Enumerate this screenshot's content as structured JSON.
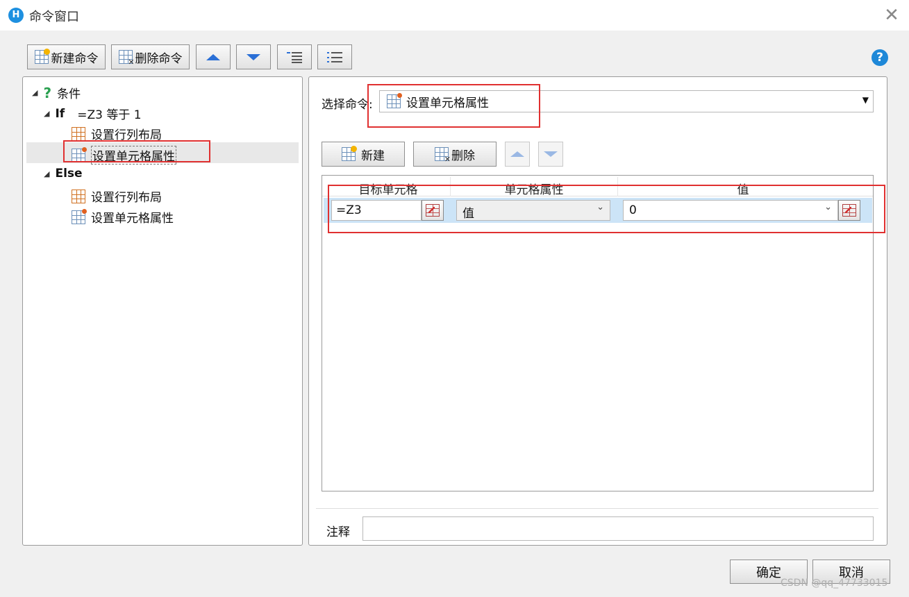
{
  "window": {
    "app_icon_letter": "H",
    "title": "命令窗口",
    "close_glyph": "✕"
  },
  "toolbar": {
    "new_command": "新建命令",
    "delete_command": "删除命令",
    "help": "?"
  },
  "tree": {
    "condition": "条件",
    "if_keyword": "If",
    "if_expr": "=Z3 等于 1",
    "if_children": [
      "设置行列布局",
      "设置单元格属性"
    ],
    "else_keyword": "Else",
    "else_children": [
      "设置行列布局",
      "设置单元格属性"
    ]
  },
  "editor": {
    "select_label": "选择命令:",
    "selected_command": "设置单元格属性",
    "new_label": "新建",
    "delete_label": "删除",
    "columns": [
      "目标单元格",
      "单元格属性",
      "值"
    ],
    "rows": [
      {
        "target": "=Z3",
        "property": "值",
        "value": "0"
      }
    ],
    "note_label": "注释",
    "note_value": ""
  },
  "footer": {
    "ok": "确定",
    "cancel": "取消"
  },
  "watermark": "CSDN @qq_47733015",
  "colors": {
    "highlight_red": "#e03030",
    "row_selected": "#cce4f7",
    "accent_blue": "#2a6fd6"
  }
}
